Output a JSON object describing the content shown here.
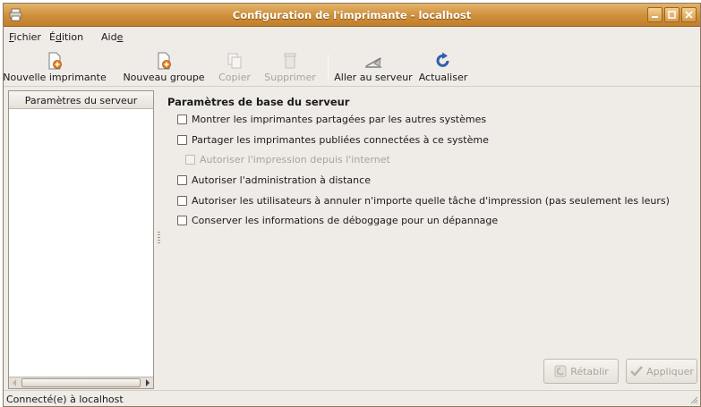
{
  "window": {
    "title": "Configuration de l'imprimante - localhost",
    "accent": "#cf8f3a"
  },
  "menubar": {
    "items": [
      {
        "pre": "",
        "mnemonic": "F",
        "post": "ichier"
      },
      {
        "pre": "É",
        "mnemonic": "d",
        "post": "ition"
      },
      {
        "pre": "Aid",
        "mnemonic": "e",
        "post": ""
      }
    ]
  },
  "toolbar": {
    "new_printer": "Nouvelle imprimante",
    "new_group": "Nouveau groupe",
    "copy": "Copier",
    "delete": "Supprimer",
    "goto_server": "Aller au serveur",
    "refresh": "Actualiser"
  },
  "sidebar": {
    "header": "Paramètres du serveur"
  },
  "settings": {
    "title": "Paramètres de base du serveur",
    "options": [
      {
        "label": "Montrer les imprimantes partagées par les autres systèmes",
        "checked": false,
        "enabled": true
      },
      {
        "label": "Partager les imprimantes publiées connectées à ce système",
        "checked": false,
        "enabled": true
      },
      {
        "label": "Autoriser l'impression depuis l'internet",
        "checked": false,
        "enabled": false
      },
      {
        "label": "Autoriser l'administration à distance",
        "checked": false,
        "enabled": true
      },
      {
        "label": "Autoriser les utilisateurs à annuler n'importe quelle tâche d'impression (pas seulement les leurs)",
        "checked": false,
        "enabled": true
      },
      {
        "label": "Conserver les informations de déboggage pour un dépannage",
        "checked": false,
        "enabled": true
      }
    ]
  },
  "buttons": {
    "revert": "Rétablir",
    "apply": "Appliquer"
  },
  "status": {
    "text": "Connecté(e) à localhost"
  }
}
